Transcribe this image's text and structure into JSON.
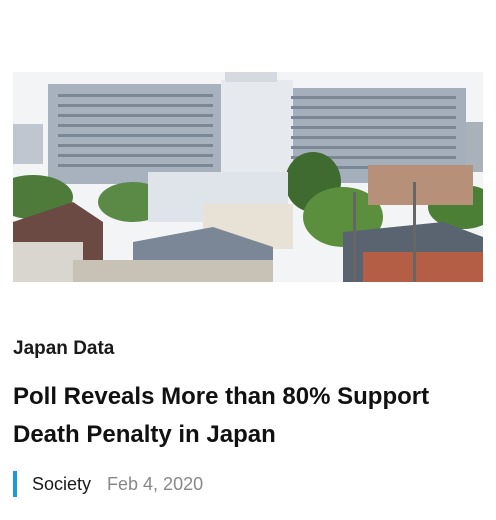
{
  "article": {
    "image_alt": "Large prison building complex behind residential houses and trees",
    "section": "Japan Data",
    "headline": "Poll Reveals More than 80% Support Death Penalty in Japan",
    "category": "Society",
    "date": "Feb 4, 2020"
  },
  "colors": {
    "accent_bar": "#1a9ad8",
    "date_text": "#888888",
    "headline_text": "#111111"
  }
}
